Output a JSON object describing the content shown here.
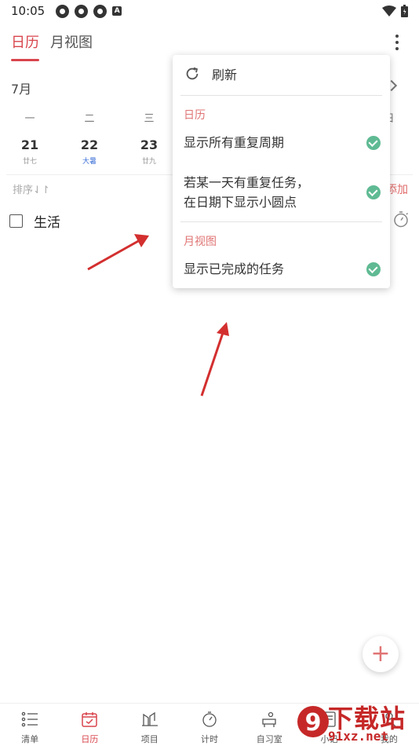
{
  "status_bar": {
    "time": "10:05",
    "icons": [
      "notification-icon",
      "notification-icon",
      "notification-icon",
      "a-icon",
      "wifi-icon",
      "battery-icon"
    ],
    "a_glyph": "A"
  },
  "top_tabs": [
    {
      "label": "日历",
      "active": true
    },
    {
      "label": "月视图",
      "active": false
    }
  ],
  "calendar": {
    "month": "7月",
    "weekdays": [
      "一",
      "二",
      "三",
      "日"
    ],
    "days": [
      {
        "num": "21",
        "lunar": "廿七"
      },
      {
        "num": "22",
        "lunar": "大暑"
      },
      {
        "num": "23",
        "lunar": "廿九"
      }
    ]
  },
  "list": {
    "sort_label": "排序⇃↾",
    "add_label": "添加",
    "task": {
      "title": "生活"
    }
  },
  "menu": {
    "refresh_label": "刷新",
    "section_calendar": "日历",
    "option_repeat": "显示所有重复周期",
    "option_dot_line1": "若某一天有重复任务，",
    "option_dot_line2": "在日期下显示小圆点",
    "section_month": "月视图",
    "option_completed": "显示已完成的任务"
  },
  "fab": {
    "label": "+"
  },
  "bottom_nav": [
    {
      "label": "清单",
      "icon": "list-icon",
      "active": false
    },
    {
      "label": "日历",
      "icon": "calendar-icon",
      "active": true
    },
    {
      "label": "项目",
      "icon": "project-icon",
      "active": false
    },
    {
      "label": "计时",
      "icon": "timer-icon",
      "active": false
    },
    {
      "label": "自习室",
      "icon": "study-room-icon",
      "active": false
    },
    {
      "label": "小记",
      "icon": "note-icon",
      "active": false
    },
    {
      "label": "我的",
      "icon": "profile-icon",
      "active": false
    }
  ],
  "watermark": {
    "top": "下载站",
    "bottom": "91xz.net",
    "logo_glyph": "9"
  },
  "colors": {
    "accent": "#d9454d",
    "menu_section": "#e07474",
    "check": "#5fba93",
    "arrow": "#d32f2f"
  }
}
